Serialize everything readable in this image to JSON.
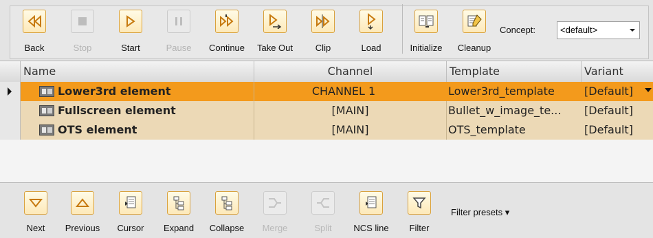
{
  "toolbar": {
    "back": "Back",
    "stop": "Stop",
    "start": "Start",
    "pause": "Pause",
    "continue": "Continue",
    "take_out": "Take Out",
    "clip": "Clip",
    "load": "Load",
    "initialize": "Initialize",
    "cleanup": "Cleanup",
    "concept_label": "Concept:",
    "concept_value": "<default>"
  },
  "grid": {
    "columns": [
      "Name",
      "Channel",
      "Template",
      "Variant"
    ],
    "rows": [
      {
        "name": "Lower3rd element",
        "channel": "CHANNEL 1",
        "template": "Lower3rd_template",
        "variant": "[Default]",
        "selected": true
      },
      {
        "name": "Fullscreen element",
        "channel": "[MAIN]",
        "template": "Bullet_w_image_te...",
        "variant": "[Default]",
        "selected": false
      },
      {
        "name": "OTS element",
        "channel": "[MAIN]",
        "template": "OTS_template",
        "variant": "[Default]",
        "selected": false
      }
    ]
  },
  "bottom_toolbar": {
    "next": "Next",
    "previous": "Previous",
    "cursor": "Cursor",
    "expand": "Expand",
    "collapse": "Collapse",
    "merge": "Merge",
    "split": "Split",
    "ncs_line": "NCS line",
    "filter": "Filter",
    "filter_presets": "Filter presets ▾"
  },
  "colors": {
    "accent_orange": "#f39a1c",
    "row_tan": "#ecd9b6",
    "icon_border": "#d9a13c"
  }
}
